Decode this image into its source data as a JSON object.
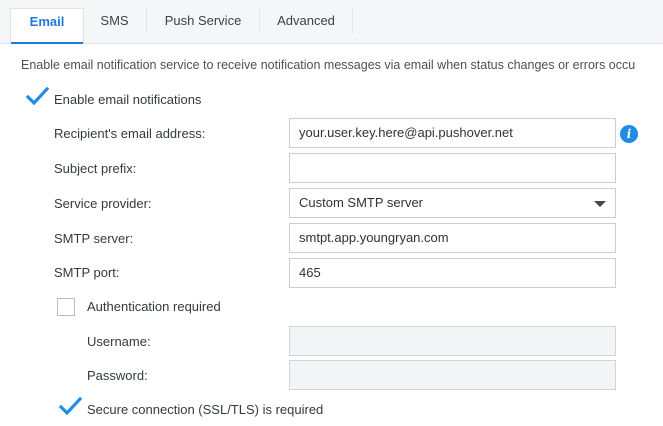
{
  "tabs": [
    {
      "label": "Email",
      "active": true
    },
    {
      "label": "SMS",
      "active": false
    },
    {
      "label": "Push Service",
      "active": false
    },
    {
      "label": "Advanced",
      "active": false
    }
  ],
  "description": "Enable email notification service to receive notification messages via email when status changes or errors occu",
  "enable_email": {
    "label": "Enable email notifications",
    "checked": true
  },
  "recipient": {
    "label": "Recipient's email address:",
    "value": "your.user.key.here@api.pushover.net",
    "info_icon": "info-icon"
  },
  "subject_prefix": {
    "label": "Subject prefix:",
    "value": ""
  },
  "service_provider": {
    "label": "Service provider:",
    "value": "Custom SMTP server"
  },
  "smtp_server": {
    "label": "SMTP server:",
    "value": "smtpt.app.youngryan.com"
  },
  "smtp_port": {
    "label": "SMTP port:",
    "value": "465"
  },
  "auth_required": {
    "label": "Authentication required",
    "checked": false
  },
  "username": {
    "label": "Username:",
    "value": ""
  },
  "password": {
    "label": "Password:",
    "value": ""
  },
  "secure_connection": {
    "label": "Secure connection (SSL/TLS) is required",
    "checked": true
  },
  "colors": {
    "accent": "#1e7bd7",
    "check": "#1f8ce6",
    "tabbar_bg": "#f4f6f8",
    "disabled_bg": "#f3f4f6"
  }
}
